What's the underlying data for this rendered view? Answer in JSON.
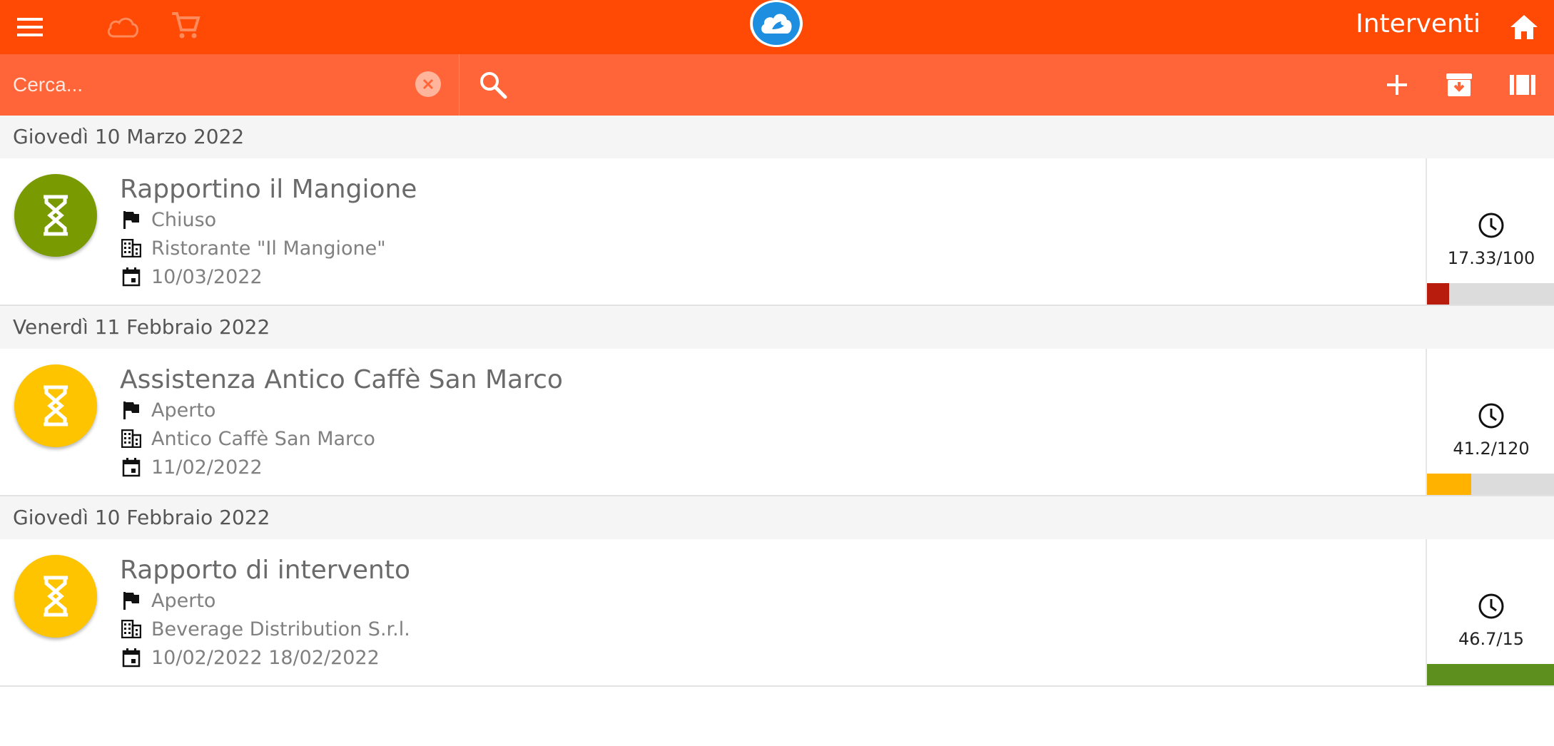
{
  "header": {
    "title": "Interventi",
    "icons": [
      "menu-icon",
      "cloud-icon",
      "cart-icon",
      "app-logo-icon",
      "home-icon"
    ],
    "color": "#ff4a05"
  },
  "search": {
    "placeholder": "Cerca...",
    "value": "",
    "bar_color": "#ff6538"
  },
  "toolbar": {
    "icons": [
      "add-icon",
      "archive-icon",
      "columns-icon"
    ]
  },
  "groups": [
    {
      "date": "Giovedì 10 Marzo 2022",
      "items": [
        {
          "title": "Rapportino il Mangione",
          "status": "Chiuso",
          "customer": "Ristorante \"Il Mangione\"",
          "dates": "10/03/2022",
          "avatar_color": "#7a9a01",
          "hours": "17.33/100",
          "progress": 0.1733,
          "bar_color": "#b71c0c"
        }
      ]
    },
    {
      "date": "Venerdì 11 Febbraio 2022",
      "items": [
        {
          "title": "Assistenza Antico Caffè San Marco",
          "status": "Aperto",
          "customer": "Antico Caffè San Marco",
          "dates": "11/02/2022",
          "avatar_color": "#ffc400",
          "hours": "41.2/120",
          "progress": 0.3433,
          "bar_color": "#ffb300"
        }
      ]
    },
    {
      "date": "Giovedì 10 Febbraio 2022",
      "items": [
        {
          "title": "Rapporto di intervento",
          "status": "Aperto",
          "customer": "Beverage Distribution S.r.l.",
          "dates": "10/02/2022 18/02/2022",
          "avatar_color": "#ffc400",
          "hours": "46.7/15",
          "progress": 1.0,
          "bar_color": "#5c8f1e"
        }
      ]
    }
  ]
}
